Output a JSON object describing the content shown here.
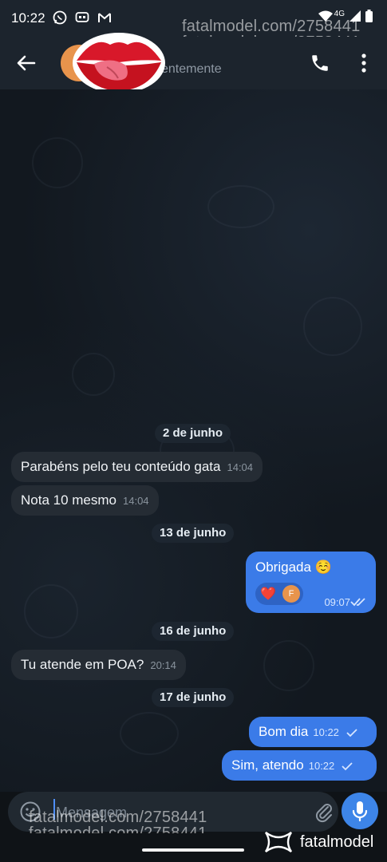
{
  "status_bar": {
    "time": "10:22",
    "network": "4G",
    "left_icons": [
      "whatsapp-icon",
      "messenger-icon",
      "gmail-icon"
    ],
    "right_icons": [
      "wifi-icon",
      "signal-icon",
      "battery-icon"
    ]
  },
  "header": {
    "last_seen": "entemente",
    "icons": [
      "back-arrow-icon",
      "phone-icon",
      "more-vertical-icon"
    ]
  },
  "messages": [
    {
      "type": "date",
      "text": "2 de junho"
    },
    {
      "type": "incoming",
      "text": "Parabéns pelo teu conteúdo gata",
      "time": "14:04"
    },
    {
      "type": "incoming",
      "text": "Nota 10 mesmo",
      "time": "14:04"
    },
    {
      "type": "date",
      "text": "13 de junho"
    },
    {
      "type": "outgoing",
      "text": "Obrigada ☺️",
      "time": "09:07",
      "reaction": "❤️",
      "reaction_avatar": "F"
    },
    {
      "type": "date",
      "text": "16 de junho"
    },
    {
      "type": "incoming",
      "text": "Tu atende em POA?",
      "time": "20:14"
    },
    {
      "type": "date",
      "text": "17 de junho"
    },
    {
      "type": "outgoing",
      "text": "Bom dia",
      "time": "10:22"
    },
    {
      "type": "outgoing",
      "text": "Sim, atendo",
      "time": "10:22"
    }
  ],
  "composer": {
    "placeholder": "Mensagem",
    "icons": [
      "emoji-icon",
      "attach-icon",
      "mic-icon"
    ]
  },
  "watermarks": {
    "top": "fatalmodel.com/2758441",
    "bottom": "fatalmodel.com/2758441",
    "brand": "fatalmodel"
  },
  "colors": {
    "outgoing_bubble": "#3b7be8",
    "incoming_bubble": "#252c34",
    "header_bg": "#1c242d",
    "accent": "#3d85e8"
  }
}
